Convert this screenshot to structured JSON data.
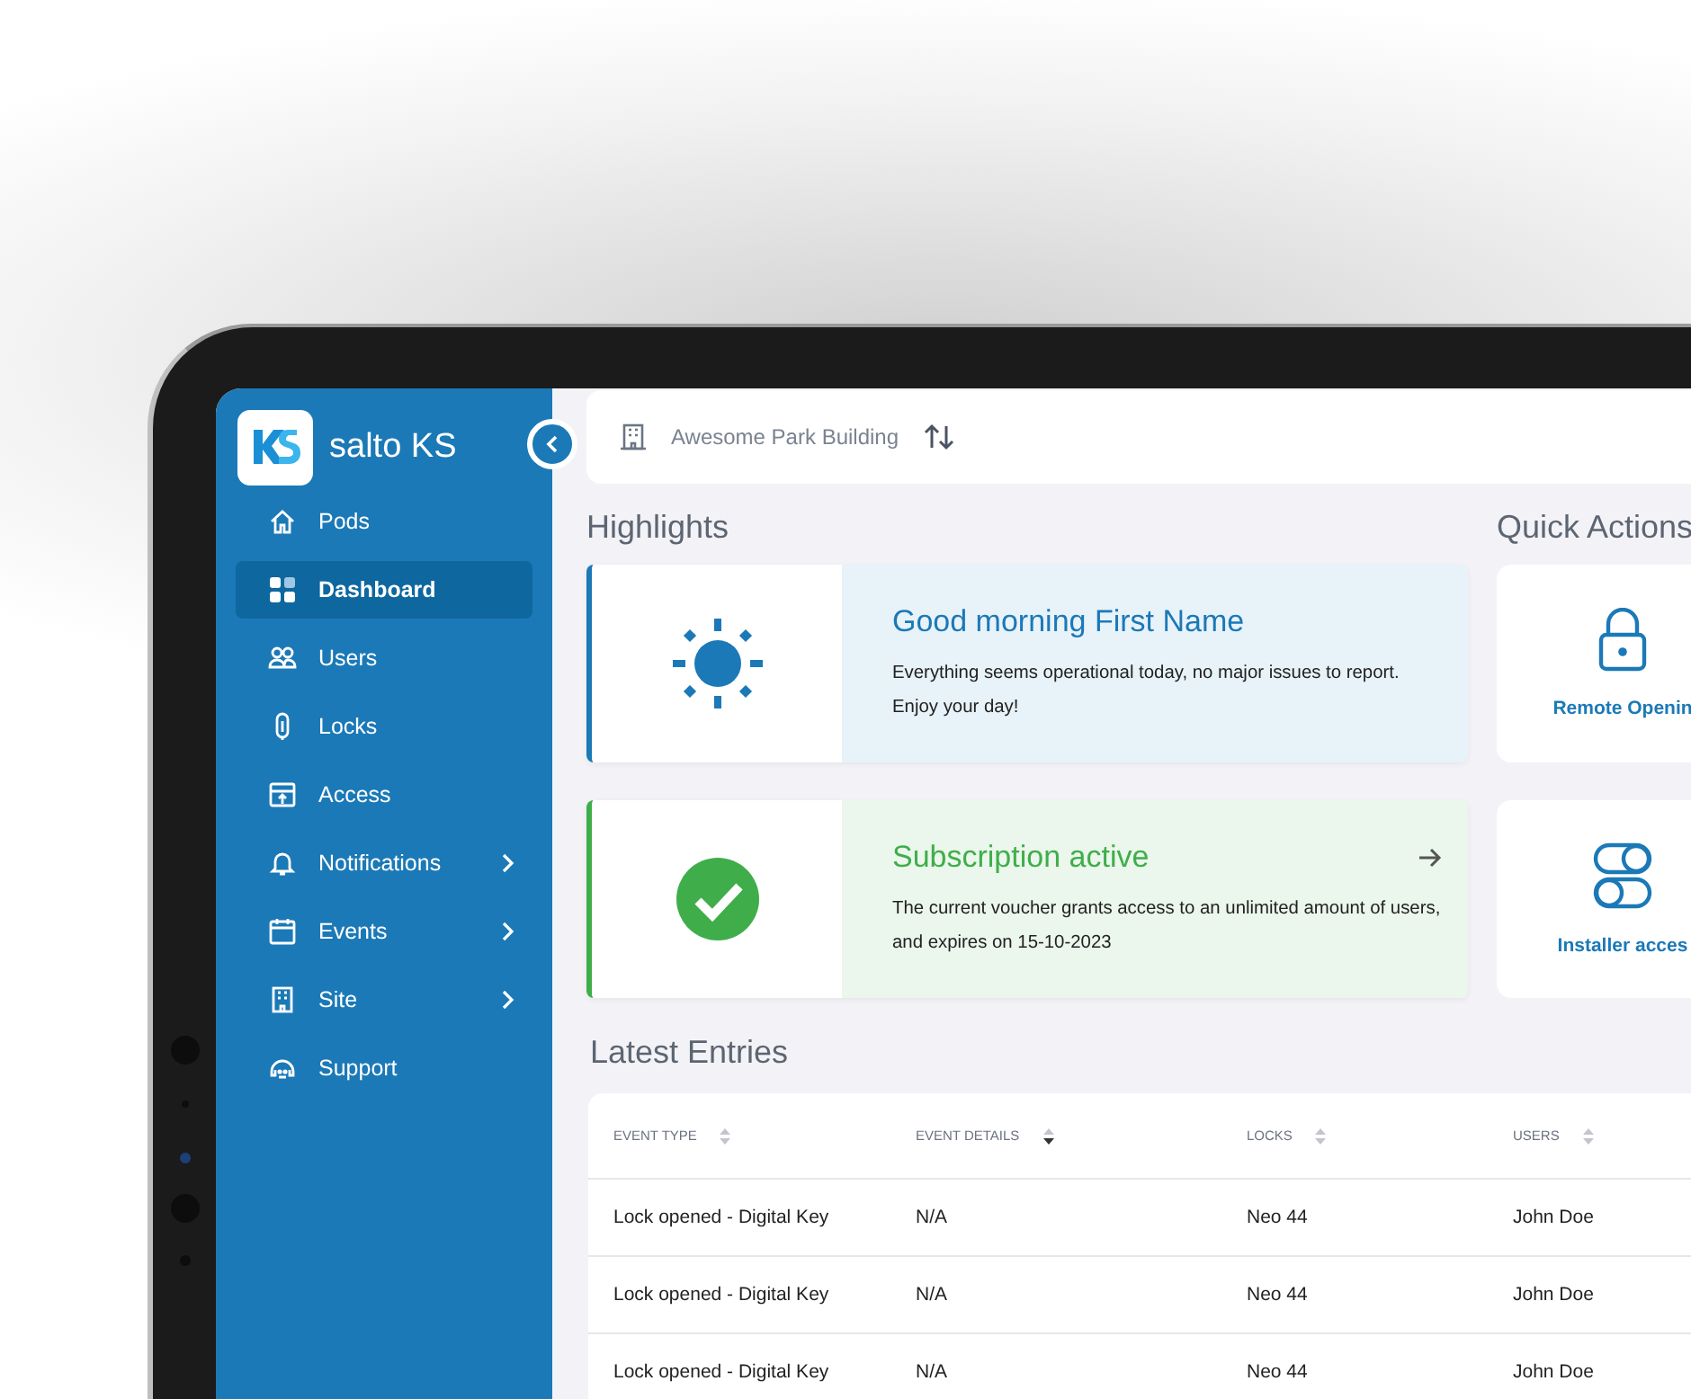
{
  "app": {
    "brand": "salto KS"
  },
  "sidebar": {
    "items": [
      {
        "label": "Pods",
        "selected": false,
        "expandable": false
      },
      {
        "label": "Dashboard",
        "selected": true,
        "expandable": false
      },
      {
        "label": "Users",
        "selected": false,
        "expandable": false
      },
      {
        "label": "Locks",
        "selected": false,
        "expandable": false
      },
      {
        "label": "Access",
        "selected": false,
        "expandable": false
      },
      {
        "label": "Notifications",
        "selected": false,
        "expandable": true
      },
      {
        "label": "Events",
        "selected": false,
        "expandable": true
      },
      {
        "label": "Site",
        "selected": false,
        "expandable": true
      },
      {
        "label": "Support",
        "selected": false,
        "expandable": false
      }
    ]
  },
  "topbar": {
    "site": "Awesome Park Building"
  },
  "highlights": {
    "title": "Highlights",
    "cards": [
      {
        "kind": "greeting",
        "title": "Good morning First Name",
        "text": "Everything seems operational today, no major issues to report.",
        "text2": "Enjoy your day!",
        "color": "#1b79b7",
        "has_arrow": false
      },
      {
        "kind": "subscription",
        "title": "Subscription active",
        "text": "The current voucher grants access to an unlimited amount of users,",
        "text2": "and expires on 15-10-2023",
        "color": "#3fae4a",
        "has_arrow": true
      }
    ]
  },
  "quick_actions": {
    "title": "Quick Actions",
    "items": [
      {
        "kind": "lock",
        "label": "Remote Openin"
      },
      {
        "kind": "toggles",
        "label": "Installer acces"
      }
    ]
  },
  "latest_entries": {
    "title": "Latest Entries",
    "columns": [
      {
        "label": "EVENT TYPE",
        "sorted": false
      },
      {
        "label": "EVENT DETAILS",
        "sorted": true
      },
      {
        "label": "LOCKS",
        "sorted": false
      },
      {
        "label": "USERS",
        "sorted": false
      }
    ],
    "rows": [
      [
        "Lock opened - Digital Key",
        "N/A",
        "Neo 44",
        "John Doe"
      ],
      [
        "Lock opened - Digital Key",
        "N/A",
        "Neo 44",
        "John Doe"
      ],
      [
        "Lock opened - Digital Key",
        "N/A",
        "Neo 44",
        "John Doe"
      ]
    ]
  }
}
